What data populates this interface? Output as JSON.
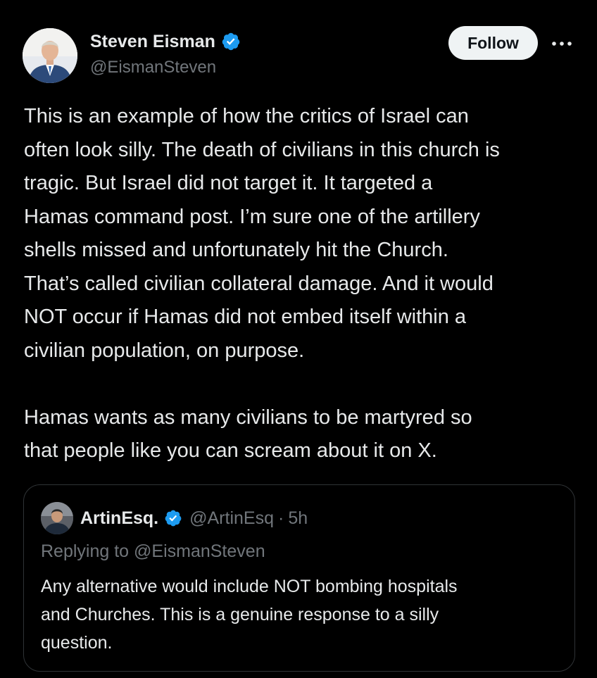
{
  "author": {
    "display_name": "Steven Eisman",
    "handle": "@EismanSteven",
    "verified_icon": "verified-badge-icon",
    "avatar_icon": "avatar"
  },
  "actions": {
    "follow_label": "Follow",
    "more_icon": "more-icon"
  },
  "tweet": {
    "paragraphs": [
      {
        "lines": [
          "This is an example of how the critics of Israel can",
          "often look silly. The death of civilians in this church is",
          "tragic.  But Israel did not target it.  It targeted a",
          "Hamas command post.  I’m sure one of the artillery",
          "shells missed and unfortunately hit the Church.",
          "That’s called civilian collateral damage.  And it would",
          "NOT occur if Hamas did not embed itself within a",
          "civilian population, on purpose."
        ]
      },
      {
        "lines": [
          "Hamas wants as many civilians to be martyred so",
          "that people like you can scream about it on X."
        ]
      }
    ]
  },
  "quote": {
    "display_name": "ArtinEsq.",
    "handle": "@ArtinEsq",
    "separator": "·",
    "time": "5h",
    "replying_to": "Replying to @EismanSteven",
    "lines": [
      "Any alternative would include NOT bombing hospitals",
      "and Churches.  This is a genuine response to a silly",
      "question."
    ]
  },
  "colors": {
    "background": "#000000",
    "text": "#e7e9ea",
    "secondary_text": "#71767b",
    "verified": "#1d9bf0",
    "border": "#2f3336",
    "follow_bg": "#eff3f4"
  }
}
